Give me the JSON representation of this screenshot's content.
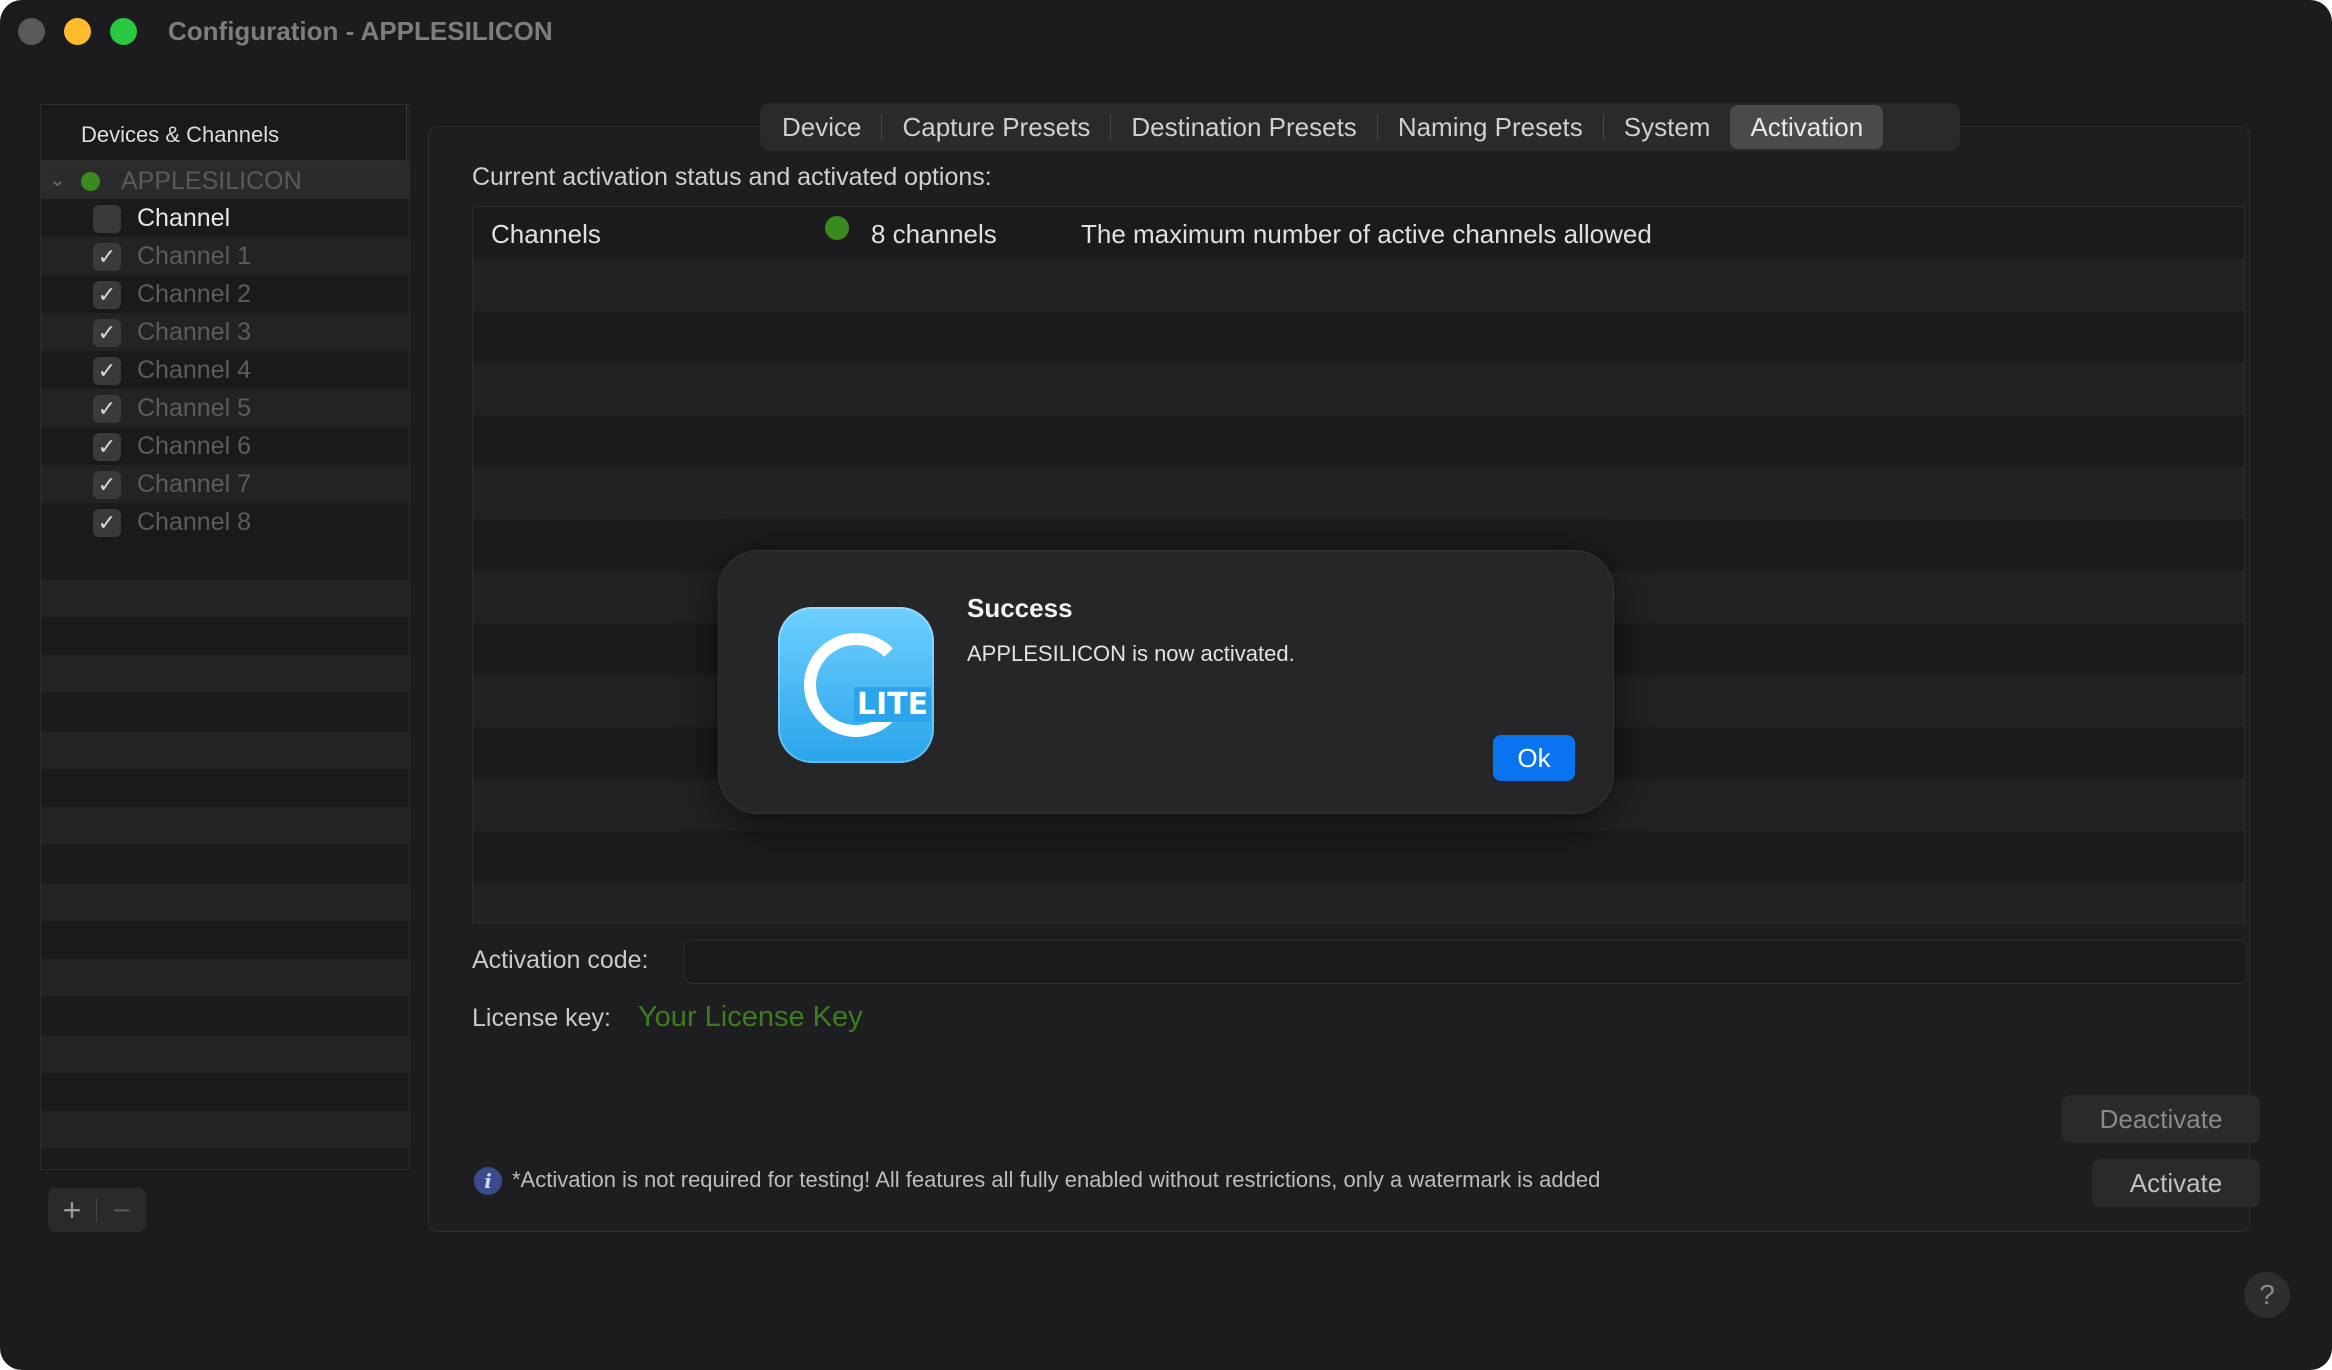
{
  "window": {
    "title": "Configuration - APPLESILICON"
  },
  "sidebar": {
    "header": "Devices & Channels",
    "device": {
      "name": "APPLESILICON"
    },
    "channel_header": "Channel",
    "channels": [
      {
        "label": "Channel 1",
        "checked": true
      },
      {
        "label": "Channel 2",
        "checked": true
      },
      {
        "label": "Channel 3",
        "checked": true
      },
      {
        "label": "Channel 4",
        "checked": true
      },
      {
        "label": "Channel 5",
        "checked": true
      },
      {
        "label": "Channel 6",
        "checked": true
      },
      {
        "label": "Channel 7",
        "checked": true
      },
      {
        "label": "Channel 8",
        "checked": true
      }
    ],
    "add_label": "+",
    "remove_label": "−"
  },
  "tabs": [
    {
      "label": "Device"
    },
    {
      "label": "Capture Presets"
    },
    {
      "label": "Destination Presets"
    },
    {
      "label": "Naming Presets"
    },
    {
      "label": "System"
    },
    {
      "label": "Activation",
      "selected": true
    }
  ],
  "activation": {
    "section_label": "Current activation status and activated options:",
    "rows": [
      {
        "name": "Channels",
        "status_color": "#3a8a1f",
        "value": "8 channels",
        "description": "The maximum number of active channels allowed"
      }
    ],
    "code_label": "Activation code:",
    "code_value": "",
    "license_label": "License key:",
    "license_value": "Your License Key",
    "deactivate_label": "Deactivate",
    "activate_label": "Activate",
    "info_icon": "i",
    "info_text": "*Activation is not required for testing! All features all fully enabled without restrictions, only a watermark is added"
  },
  "help_label": "?",
  "modal": {
    "title": "Success",
    "message": "APPLESILICON is now activated.",
    "ok_label": "Ok",
    "icon_text": "LITE"
  },
  "colors": {
    "accent": "#0a74f0",
    "status_green": "#3a8a1f",
    "license_green": "#3c7d1e"
  }
}
